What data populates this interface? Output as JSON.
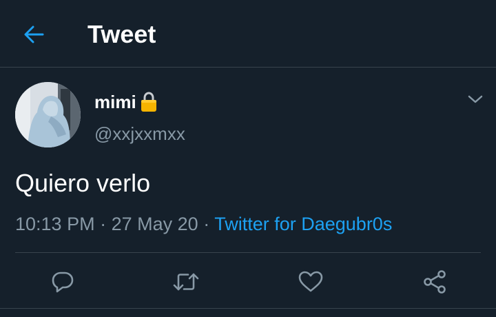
{
  "header": {
    "back_icon": "arrow-left-icon",
    "title": "Tweet"
  },
  "tweet": {
    "author": {
      "display_name": "mimi",
      "protected_icon": "lock-icon",
      "handle": "@xxjxxmxx"
    },
    "text": "Quiero verlo",
    "time": "10:13 PM",
    "separator": "·",
    "date": "27 May 20",
    "source": "Twitter for Daegubr0s"
  },
  "actions": [
    {
      "icon": "reply-icon"
    },
    {
      "icon": "retweet-icon"
    },
    {
      "icon": "like-icon"
    },
    {
      "icon": "share-icon"
    }
  ],
  "colors": {
    "background": "#15202b",
    "accent": "#1da1f2",
    "secondary_text": "#8899a6",
    "divider": "#38444d"
  }
}
